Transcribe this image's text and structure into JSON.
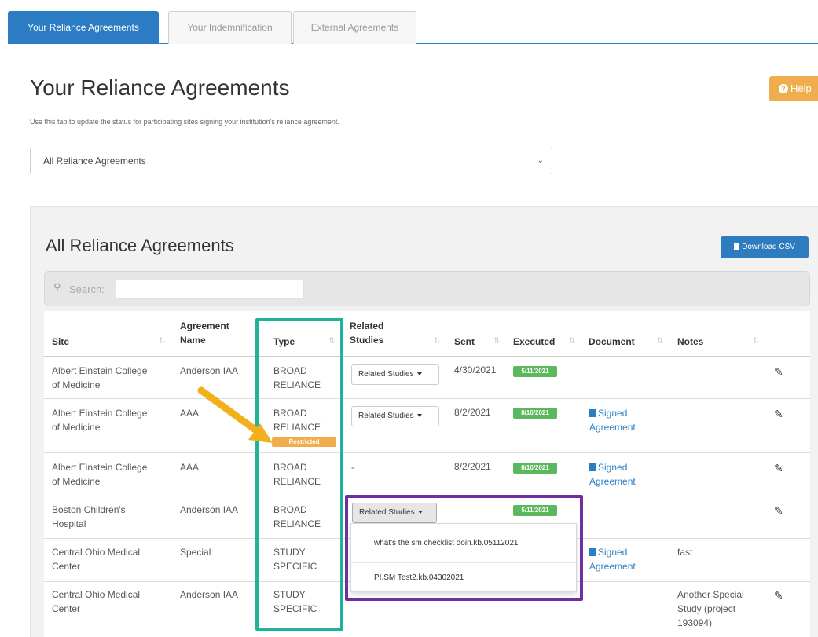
{
  "tabs": [
    {
      "label": "Your Reliance Agreements",
      "active": true
    },
    {
      "label": "Your Indemnification",
      "active": false
    },
    {
      "label": "External Agreements",
      "active": false
    }
  ],
  "page_title": "Your Reliance Agreements",
  "help_label": "Help",
  "subtitle": "Use this tab to update the status for participating sites signing your institution's reliance agreement.",
  "filter_select": {
    "value": "All Reliance Agreements"
  },
  "panel_title": "All Reliance Agreements",
  "download_csv_label": "Download CSV",
  "search": {
    "label": "Search:",
    "value": ""
  },
  "columns": {
    "site": "Site",
    "agreement_name_1": "Agreement",
    "agreement_name_2": "Name",
    "type": "Type",
    "related_1": "Related",
    "related_2": "Studies",
    "sent": "Sent",
    "executed": "Executed",
    "document": "Document",
    "notes": "Notes"
  },
  "rows": [
    {
      "site_1": "Albert Einstein College",
      "site_2": "of Medicine",
      "agreement": "Anderson IAA",
      "type_1": "BROAD",
      "type_2": "RELIANCE",
      "related": "Related Studies",
      "sent": "4/30/2021",
      "executed": "5/11/2021"
    },
    {
      "site_1": "Albert Einstein College",
      "site_2": "of Medicine",
      "agreement": "AAA",
      "type_1": "BROAD",
      "type_2": "RELIANCE",
      "restricted": "Restricted",
      "related": "Related Studies",
      "sent": "8/2/2021",
      "executed": "8/16/2021",
      "document_1": "Signed",
      "document_2": "Agreement"
    },
    {
      "site_1": "Albert Einstein College",
      "site_2": "of Medicine",
      "agreement": "AAA",
      "type_1": "BROAD",
      "type_2": "RELIANCE",
      "related": "-",
      "sent": "8/2/2021",
      "executed": "8/16/2021",
      "document_1": "Signed",
      "document_2": "Agreement"
    },
    {
      "site_1": "Boston Children's",
      "site_2": "Hospital",
      "agreement": "Anderson IAA",
      "type_1": "BROAD",
      "type_2": "RELIANCE",
      "related": "Related Studies",
      "executed": "5/11/2021"
    },
    {
      "site_1": "Central Ohio Medical",
      "site_2": "Center",
      "agreement": "Special",
      "type_1": "STUDY",
      "type_2": "SPECIFIC",
      "document_1": "Signed",
      "document_2": "Agreement",
      "notes_1": "fast"
    },
    {
      "site_1": "Central Ohio Medical",
      "site_2": "Center",
      "agreement": "Anderson IAA",
      "type_1": "STUDY",
      "type_2": "SPECIFIC",
      "notes_1": "Another Special",
      "notes_2": "Study (project",
      "notes_3": "193094)"
    }
  ],
  "related_studies_dropdown": [
    "what's the sm checklist doin.kb.05112021",
    "PI.SM Test2.kb.04302021"
  ],
  "colors": {
    "primary": "#2c7cc4",
    "success": "#5cb85c",
    "warning": "#f0ad4e",
    "highlight_type_column": "#1fb39a",
    "highlight_dropdown": "#6f2fa0",
    "arrow": "#f2b01e"
  },
  "icons": [
    "help-icon",
    "download-file-icon",
    "search-icon",
    "sort-icon",
    "caret-down-icon",
    "document-icon",
    "pencil-icon",
    "arrow-annotation-icon"
  ]
}
